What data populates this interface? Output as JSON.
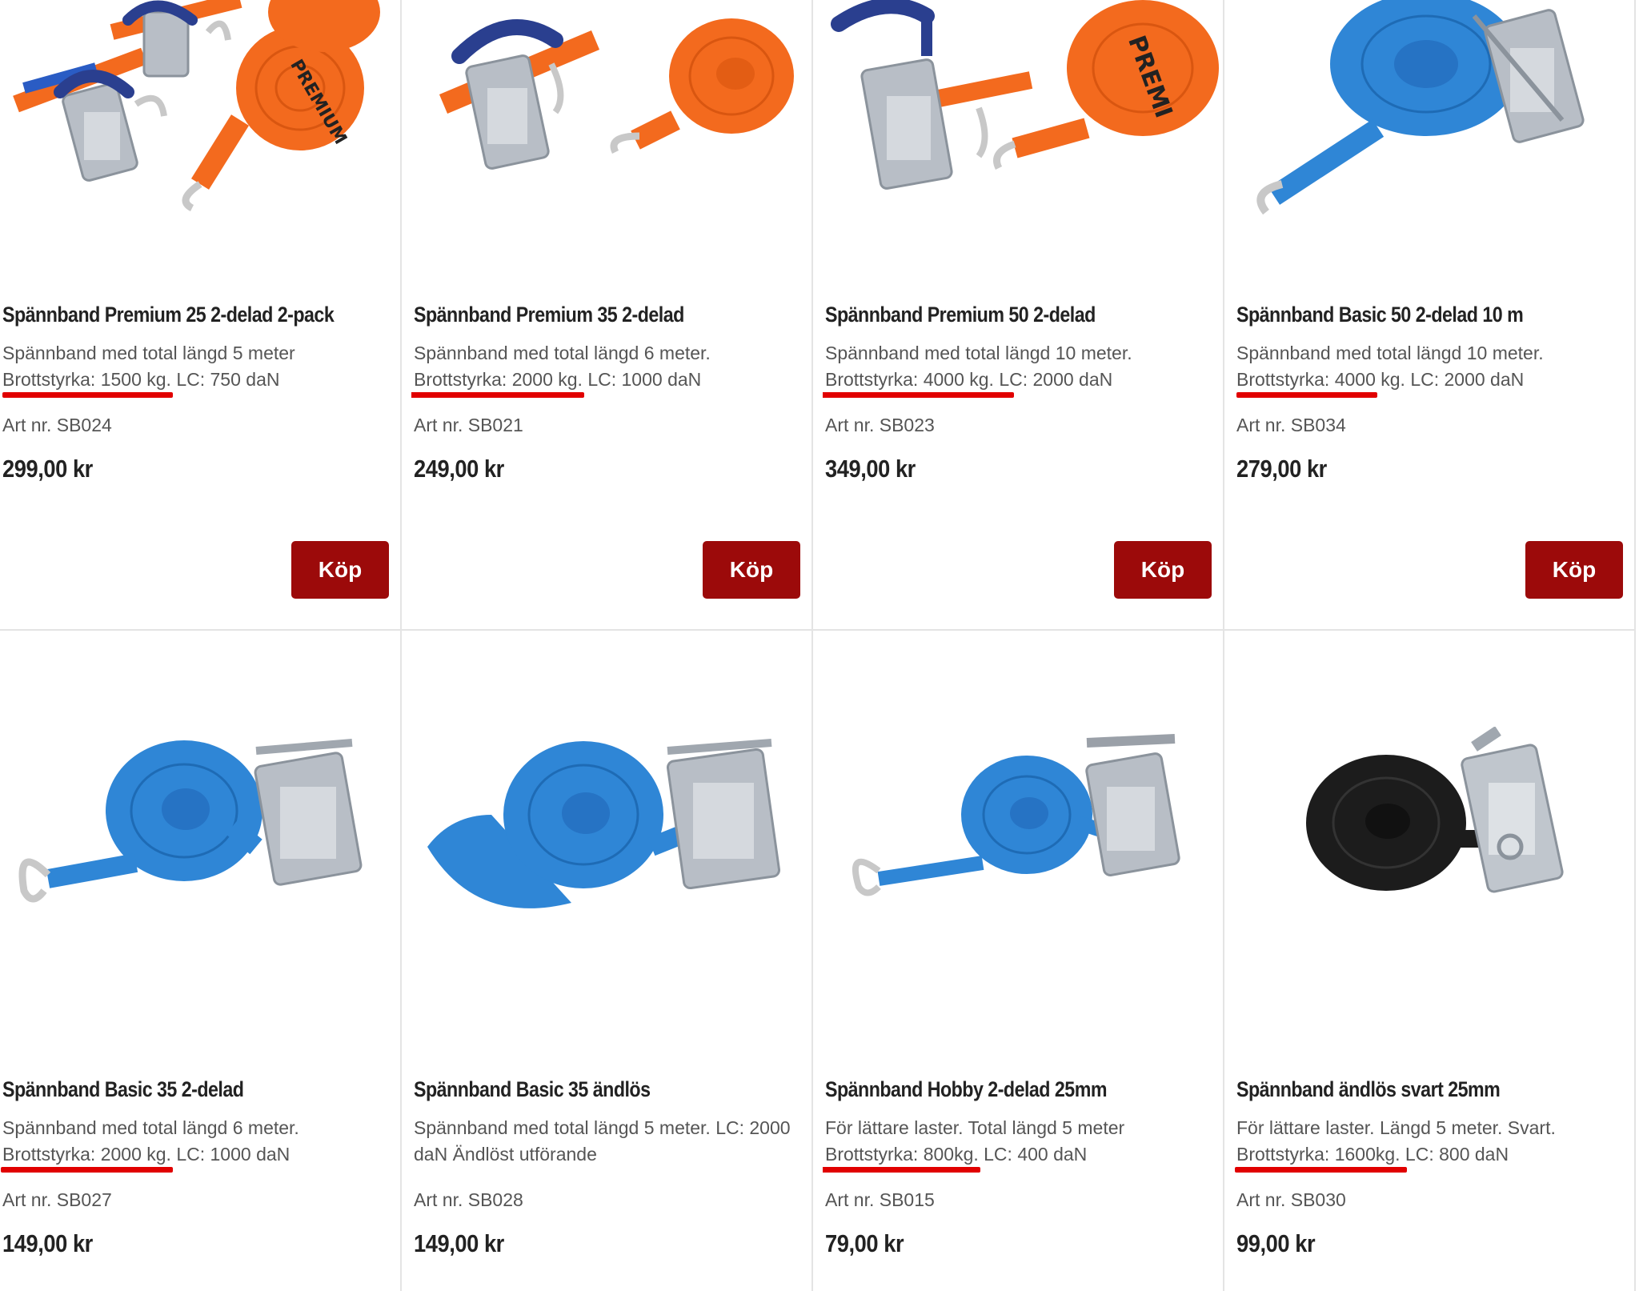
{
  "products": [
    {
      "title": "Spännband Premium 25 2-delad 2-pack",
      "desc_line1": "Spännband med total längd 5 meter",
      "spec_strength": "Brottstyrka: 1500 kg.",
      "spec_rest": " LC: 750 daN",
      "art": "Art nr. SB024",
      "price": "299,00 kr",
      "buy": "Köp",
      "image": "orange-ratchet-strap-2pack",
      "strap_color": "#f36a1e"
    },
    {
      "title": "Spännband Premium 35 2-delad",
      "desc_line1": "Spännband med total längd 6 meter.",
      "spec_strength": "Brottstyrka: 2000 kg.",
      "spec_rest": " LC: 1000 daN",
      "art": "Art nr. SB021",
      "price": "249,00 kr",
      "buy": "Köp",
      "image": "orange-ratchet-strap",
      "strap_color": "#f36a1e"
    },
    {
      "title": "Spännband Premium 50 2-delad",
      "desc_line1": "Spännband med total längd 10 meter.",
      "spec_strength": "Brottstyrka: 4000",
      "spec_rest": " kg. LC: 2000 daN",
      "art": "Art nr. SB023",
      "price": "349,00 kr",
      "buy": "Köp",
      "image": "orange-premium-ratchet-strap",
      "strap_color": "#f36a1e"
    },
    {
      "title": "Spännband Basic 50 2-delad 10 m",
      "desc_line1": "Spännband med total längd 10 meter.",
      "spec_strength": "Brottstyrka: 4000",
      "spec_rest": " kg. LC: 2000 daN",
      "art": "Art nr. SB034",
      "price": "279,00 kr",
      "buy": "Köp",
      "image": "blue-ratchet-strap",
      "strap_color": "#2f86d6"
    },
    {
      "title": "Spännband Basic 35 2-delad",
      "desc_line1": "Spännband med total längd 6 meter.",
      "spec_strength": "Brottstyrka: 2000 kg.",
      "spec_rest": " LC: 1000 daN",
      "art": "Art nr. SB027",
      "price": "149,00 kr",
      "image": "blue-ratchet-strap-hook",
      "strap_color": "#2f86d6"
    },
    {
      "title": "Spännband Basic 35 ändlös",
      "desc_line1": "Spännband med total längd 5 meter. LC: 2000",
      "desc_line2": "daN Ändlöst utförande",
      "art": "Art nr. SB028",
      "price": "149,00 kr",
      "image": "blue-endless-strap",
      "strap_color": "#2f86d6"
    },
    {
      "title": "Spännband Hobby 2-delad 25mm",
      "desc_line1": "För lättare laster. Total längd 5 meter",
      "spec_strength": "Brottstyrka: 800kg.",
      "spec_rest": " LC: 400 daN",
      "art": "Art nr. SB015",
      "price": "79,00 kr",
      "image": "blue-hobby-strap",
      "strap_color": "#2f86d6"
    },
    {
      "title": "Spännband ändlös svart 25mm",
      "desc_line1": "För lättare laster. Längd 5 meter. Svart.",
      "spec_strength": "Brottstyrka: 1600kg.",
      "spec_rest": " LC: 800 daN",
      "art": "Art nr. SB030",
      "price": "99,00 kr",
      "image": "black-endless-strap",
      "strap_color": "#1c1c1c"
    }
  ],
  "colors": {
    "buy_button": "#9c0a0a",
    "highlight_underline": "#e10000",
    "divider": "#e4e4e4"
  }
}
